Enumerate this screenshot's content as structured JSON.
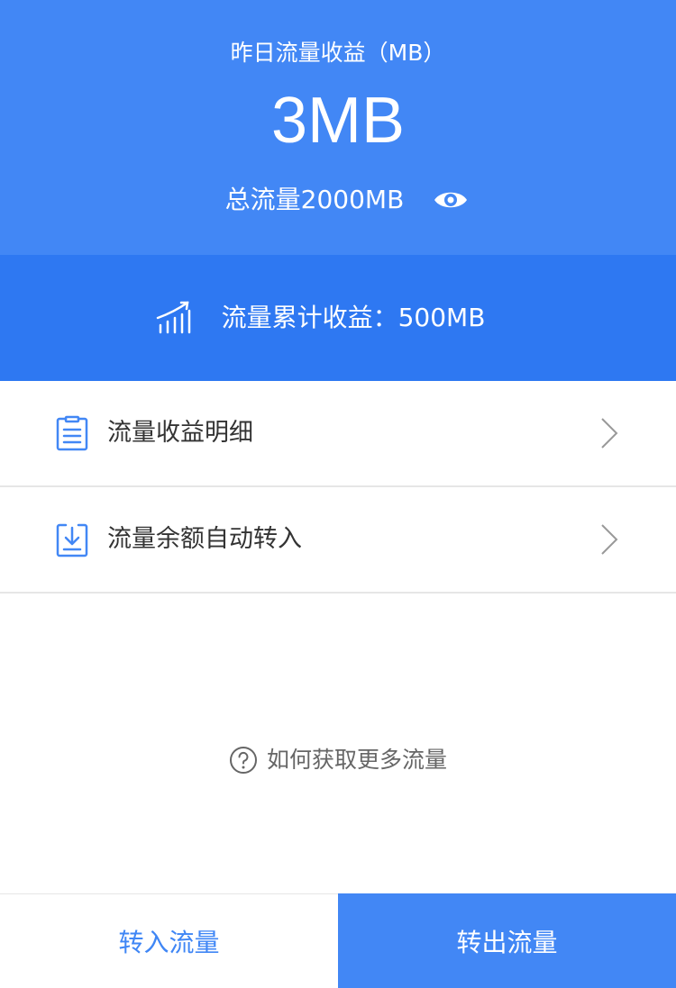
{
  "header": {
    "yesterday_label": "昨日流量收益（MB）",
    "yesterday_value": "3MB",
    "total_label": "总流量2000MB"
  },
  "cumulative": {
    "label": "流量累计收益：500MB"
  },
  "menu": [
    {
      "label": "流量收益明细",
      "icon": "list-icon"
    },
    {
      "label": "流量余额自动转入",
      "icon": "download-icon"
    }
  ],
  "help": {
    "label": "如何获取更多流量"
  },
  "bottom": {
    "transfer_in": "转入流量",
    "transfer_out": "转出流量"
  },
  "colors": {
    "primary": "#4287f5",
    "primary_dark": "#2e78f2",
    "text": "#333333",
    "muted": "#666666"
  }
}
